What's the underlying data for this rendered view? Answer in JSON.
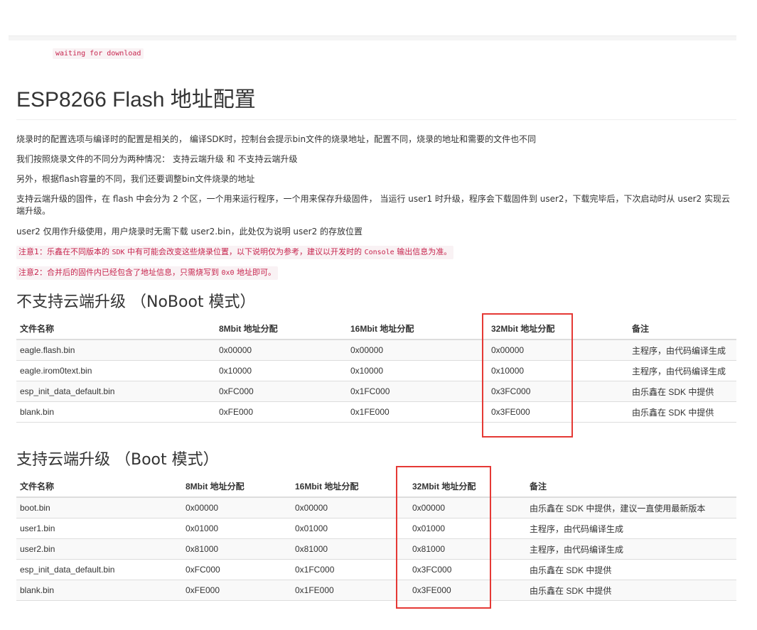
{
  "status": {
    "waiting_text": "waiting for download"
  },
  "article": {
    "title": "ESP8266 Flash 地址配置",
    "paragraphs": [
      "烧录时的配置选项与编译时的配置是相关的， 编译SDK时，控制台会提示bin文件的烧录地址，配置不同，烧录的地址和需要的文件也不同",
      "我们按照烧录文件的不同分为两种情况： 支持云端升级 和 不支持云端升级",
      "另外，根据flash容量的不同，我们还要调整bin文件烧录的地址",
      "支持云端升级的固件，在 flash 中会分为 2 个区，一个用来运行程序，一个用来保存升级固件， 当运行 user1 时升级，程序会下载固件到 user2，下载完毕后，下次启动时从 user2 实现云端升级。",
      "user2 仅用作升级使用，用户烧录时无需下载 user2.bin，此处仅为说明 user2 的存放位置"
    ],
    "note1": {
      "before": "注意1：乐鑫在不同版本的 ",
      "code1": "SDK",
      "middle": " 中有可能会改变这些烧录位置，以下说明仅为参考，建议以开发时的 ",
      "code2": "Console",
      "after": " 输出信息为准。"
    },
    "note2": {
      "before": "注意2：合并后的固件内已经包含了地址信息，只需烧写到 ",
      "code": "0x0",
      "after": " 地址即可。"
    }
  },
  "noboot": {
    "heading": "不支持云端升级 （NoBoot 模式）",
    "columns": [
      "文件名称",
      "8Mbit 地址分配",
      "16Mbit 地址分配",
      "32Mbit 地址分配",
      "备注"
    ],
    "rows": [
      [
        "eagle.flash.bin",
        "0x00000",
        "0x00000",
        "0x00000",
        "主程序，由代码编译生成"
      ],
      [
        "eagle.irom0text.bin",
        "0x10000",
        "0x10000",
        "0x10000",
        "主程序，由代码编译生成"
      ],
      [
        "esp_init_data_default.bin",
        "0xFC000",
        "0x1FC000",
        "0x3FC000",
        "由乐鑫在 SDK 中提供"
      ],
      [
        "blank.bin",
        "0xFE000",
        "0x1FE000",
        "0x3FE000",
        "由乐鑫在 SDK 中提供"
      ]
    ]
  },
  "boot": {
    "heading": "支持云端升级 （Boot 模式）",
    "columns": [
      "文件名称",
      "8Mbit 地址分配",
      "16Mbit 地址分配",
      "32Mbit 地址分配",
      "备注"
    ],
    "rows": [
      [
        "boot.bin",
        "0x00000",
        "0x00000",
        "0x00000",
        "由乐鑫在 SDK 中提供，建议一直使用最新版本"
      ],
      [
        "user1.bin",
        "0x01000",
        "0x01000",
        "0x01000",
        "主程序，由代码编译生成"
      ],
      [
        "user2.bin",
        "0x81000",
        "0x81000",
        "0x81000",
        "主程序，由代码编译生成"
      ],
      [
        "esp_init_data_default.bin",
        "0xFC000",
        "0x1FC000",
        "0x3FC000",
        "由乐鑫在 SDK 中提供"
      ],
      [
        "blank.bin",
        "0xFE000",
        "0x1FE000",
        "0x3FE000",
        "由乐鑫在 SDK 中提供"
      ]
    ]
  },
  "colors": {
    "highlight_box": "#e53935",
    "note_text": "#c7254e",
    "note_bg": "#f9f2f4"
  }
}
